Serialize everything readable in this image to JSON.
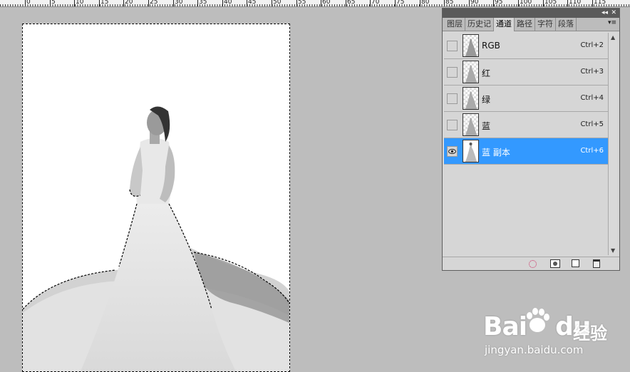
{
  "ruler": {
    "labels": [
      "0",
      "5",
      "10",
      "15",
      "20",
      "25",
      "30",
      "35",
      "40",
      "45",
      "50",
      "55",
      "60",
      "65",
      "70",
      "75",
      "80",
      "85",
      "90",
      "95",
      "100",
      "105",
      "110",
      "115"
    ]
  },
  "panel": {
    "tabs": [
      "图层",
      "历史记",
      "通道",
      "路径",
      "字符",
      "段落"
    ],
    "active_tab": "通道",
    "channels": [
      {
        "name": "RGB",
        "shortcut": "Ctrl+2",
        "visible": false,
        "selected": false
      },
      {
        "name": "红",
        "shortcut": "Ctrl+3",
        "visible": false,
        "selected": false
      },
      {
        "name": "绿",
        "shortcut": "Ctrl+4",
        "visible": false,
        "selected": false
      },
      {
        "name": "蓝",
        "shortcut": "Ctrl+5",
        "visible": false,
        "selected": false
      },
      {
        "name": "蓝 副本",
        "shortcut": "Ctrl+6",
        "visible": true,
        "selected": true
      }
    ],
    "icons": {
      "collapse": "double-left-arrow-icon",
      "close": "close-icon",
      "menu": "panel-menu-icon",
      "load_selection": "load-channel-as-selection-icon",
      "save_selection": "save-selection-as-channel-icon",
      "new_channel": "new-channel-icon",
      "delete": "trash-icon"
    }
  },
  "watermark": {
    "logo": "Bai",
    "logo_suffix": "du",
    "cn": "经验",
    "url": "jingyan.baidu.com"
  },
  "colors": {
    "selected_row": "#3399ff",
    "background": "#bdbdbd"
  }
}
